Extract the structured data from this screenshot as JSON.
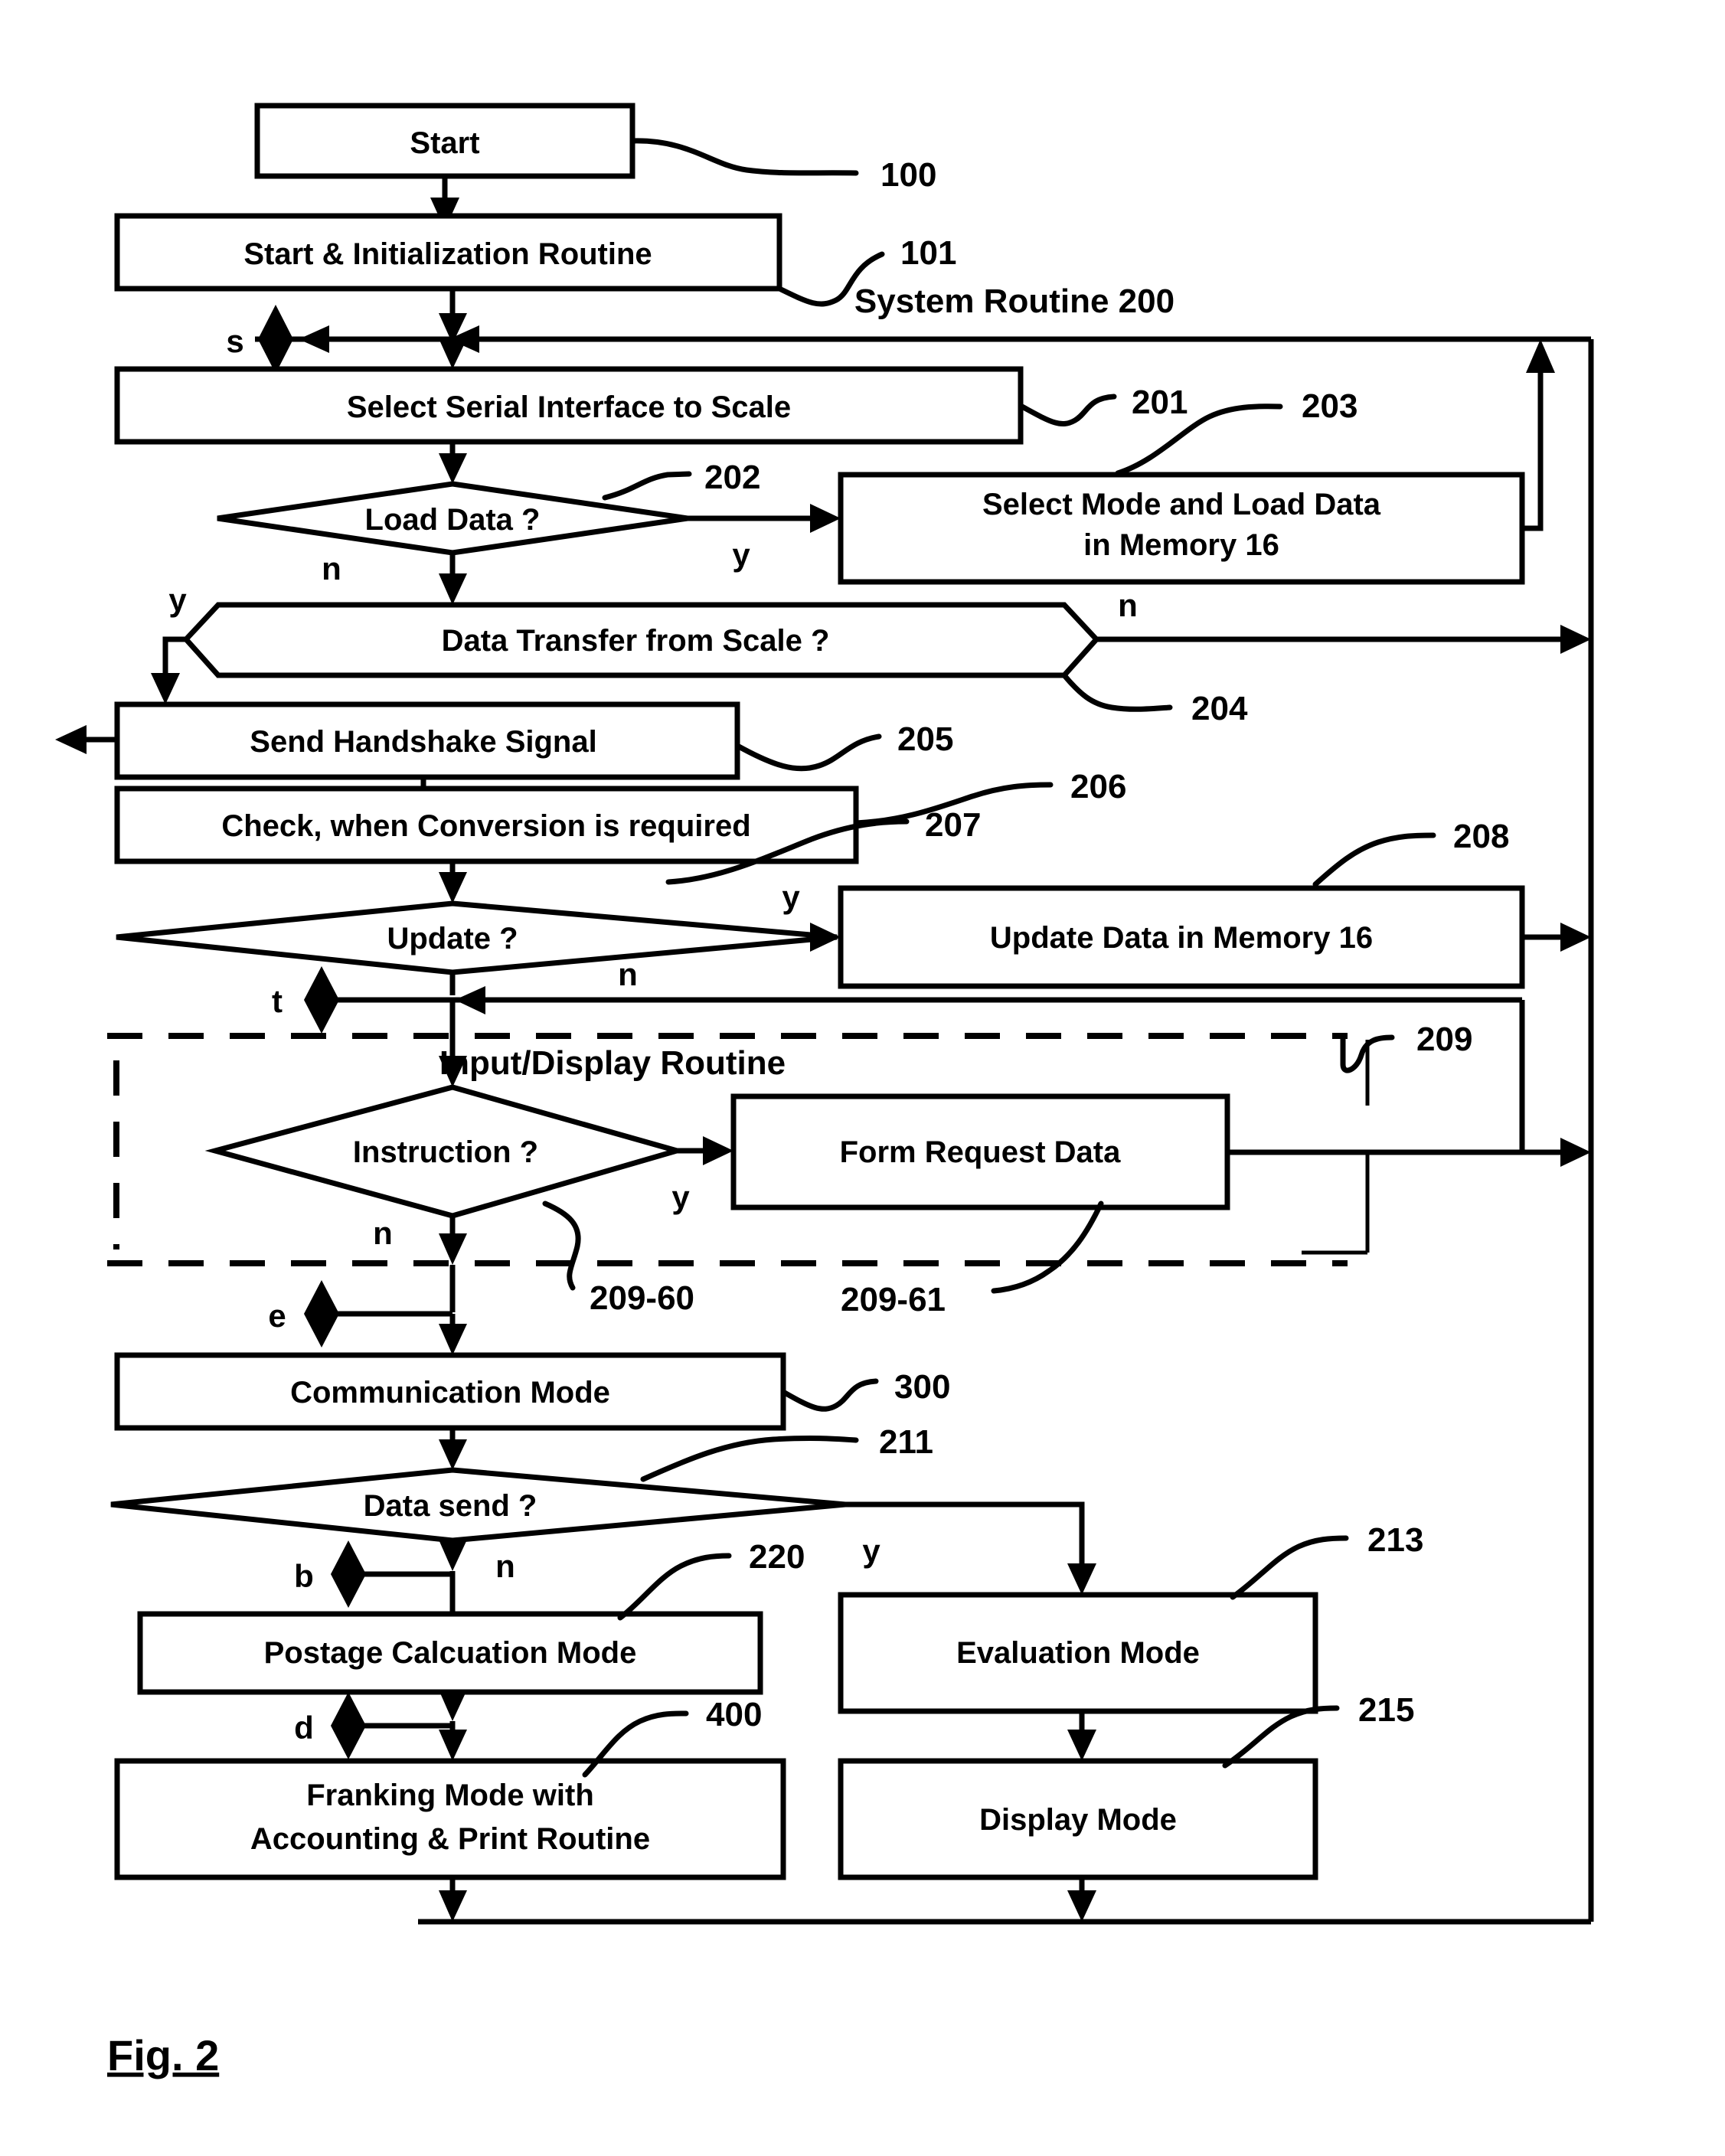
{
  "figure": {
    "caption": "Fig. 2",
    "system_routine_label": "System Routine  200",
    "input_display_routine_label": "Input/Display Routine"
  },
  "nodes": {
    "start": {
      "label": "Start",
      "ref": "100",
      "shape": "process"
    },
    "init": {
      "label": "Start & Initialization Routine",
      "ref": "101",
      "shape": "process"
    },
    "select_serial": {
      "label": "Select Serial Interface  to Scale",
      "ref": "201",
      "shape": "process"
    },
    "load_data": {
      "label": "Load Data ?",
      "ref": "202",
      "shape": "decision"
    },
    "select_mode": {
      "label_line1": "Select Mode and Load  Data",
      "label_line2": "in Memory 16",
      "ref": "203",
      "shape": "process"
    },
    "data_transfer": {
      "label": "Data Transfer from  Scale ?",
      "ref": "204",
      "shape": "hexagon"
    },
    "handshake": {
      "label": "Send Handshake Signal",
      "ref": "205",
      "shape": "process"
    },
    "check_conversion": {
      "label": "Check, when Conversion is required",
      "ref": "206",
      "shape": "process"
    },
    "update_q": {
      "label": "Update ?",
      "ref": "207",
      "shape": "decision"
    },
    "update_mem": {
      "label": "Update Data in  Memory  16",
      "ref": "208",
      "shape": "process"
    },
    "input_display": {
      "ref": "209",
      "shape": "group"
    },
    "instruction_q": {
      "label": "Instruction  ?",
      "ref": "209-60",
      "shape": "decision"
    },
    "form_request": {
      "label": "Form Request  Data",
      "ref": "209-61",
      "shape": "process"
    },
    "communication": {
      "label": "Communication  Mode",
      "ref": "300",
      "shape": "process"
    },
    "data_send": {
      "label": "Data send ?",
      "ref": "211",
      "shape": "decision"
    },
    "postage": {
      "label": "Postage Calcuation  Mode",
      "ref": "220",
      "shape": "process"
    },
    "franking": {
      "label_line1": "Franking Mode  with",
      "label_line2": "Accounting & Print Routine",
      "ref": "400",
      "shape": "process"
    },
    "evaluation": {
      "label": "Evaluation  Mode",
      "ref": "213",
      "shape": "process"
    },
    "display": {
      "label": "Display  Mode",
      "ref": "215",
      "shape": "process"
    }
  },
  "branch_labels": {
    "load_data_yes": "y",
    "load_data_no": "n",
    "data_transfer_yes": "y",
    "data_transfer_no": "n",
    "update_yes": "y",
    "update_no": "n",
    "instruction_yes": "y",
    "instruction_no": "n",
    "data_send_yes": "y",
    "data_send_no": "n"
  },
  "connectors": {
    "s": "s",
    "t": "t",
    "e": "e",
    "b": "b",
    "d": "d"
  },
  "ref_numbers": {
    "n100": "100",
    "n101": "101",
    "n200": "System Routine  200",
    "n201": "201",
    "n202": "202",
    "n203": "203",
    "n204": "204",
    "n205": "205",
    "n206": "206",
    "n207": "207",
    "n208": "208",
    "n209": "209",
    "n209_60": "209-60",
    "n209_61": "209-61",
    "n211": "211",
    "n213": "213",
    "n215": "215",
    "n220": "220",
    "n300": "300",
    "n400": "400"
  },
  "colors": {
    "stroke": "#000000",
    "fill": "#ffffff",
    "background": "#ffffff"
  }
}
